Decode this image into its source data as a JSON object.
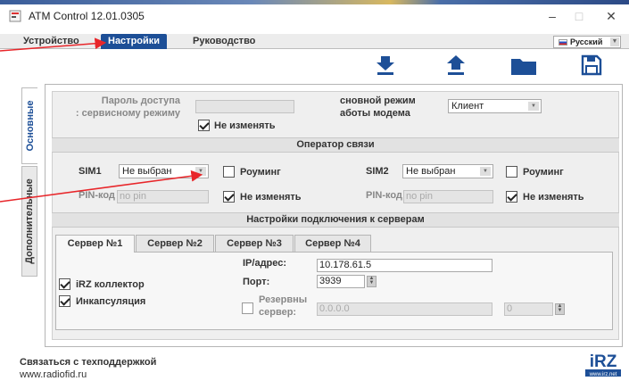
{
  "window": {
    "title": "ATM Control 12.01.0305",
    "minimize": "–",
    "maximize": "□",
    "close": "✕"
  },
  "menu": {
    "items": [
      "Устройство",
      "Настройки",
      "Руководство"
    ],
    "active": "Настройки",
    "language": "Русский"
  },
  "toolbar": {
    "icons": [
      "download-icon",
      "upload-icon",
      "folder-icon",
      "save-icon"
    ]
  },
  "side_tabs": [
    "Основные",
    "Дополнительные"
  ],
  "access": {
    "password_label_line1": "Пароль доступа",
    "password_label_line2": ": сервисному режиму",
    "password_value": "",
    "no_change_label": "Не изменять",
    "no_change_checked": true,
    "mode_label_line1": "сновной режим",
    "mode_label_line2": "аботы модема",
    "mode_value": "Клиент"
  },
  "operator": {
    "header": "Оператор связи",
    "sim1_label": "SIM1",
    "sim1_value": "Не выбран",
    "sim1_roaming_label": "Роуминг",
    "sim1_roaming_checked": false,
    "sim1_pin_label": "PIN-код",
    "sim1_pin_placeholder": "no pin",
    "sim1_no_change_label": "Не изменять",
    "sim1_no_change_checked": true,
    "sim2_label": "SIM2",
    "sim2_value": "Не выбран",
    "sim2_roaming_label": "Роуминг",
    "sim2_roaming_checked": false,
    "sim2_pin_label": "PIN-код",
    "sim2_pin_placeholder": "no pin",
    "sim2_no_change_label": "Не изменять",
    "sim2_no_change_checked": true
  },
  "servers": {
    "header": "Настройки подключения к серверам",
    "tabs": [
      "Сервер №1",
      "Сервер №2",
      "Сервер №3",
      "Сервер №4"
    ],
    "active_tab": "Сервер №1",
    "ip_label": "IP/адрес:",
    "ip_value": "10.178.61.5",
    "port_label": "Порт:",
    "port_value": "3939",
    "collector_label": "iRZ коллектор",
    "collector_checked": true,
    "encapsulation_label": "Инкапсуляция",
    "encapsulation_checked": true,
    "backup_label_line1": "Резервны",
    "backup_label_line2": "сервер:",
    "backup_checked": false,
    "backup_ip_placeholder": "0.0.0.0",
    "backup_port_placeholder": "0"
  },
  "footer": {
    "support": "Связаться с техподдержкой",
    "site": "www.radiofid.ru",
    "logo_text": "iRZ",
    "logo_site": "www.irz.net"
  },
  "colors": {
    "accent": "#1d4f97",
    "annotation": "#e8262a"
  }
}
